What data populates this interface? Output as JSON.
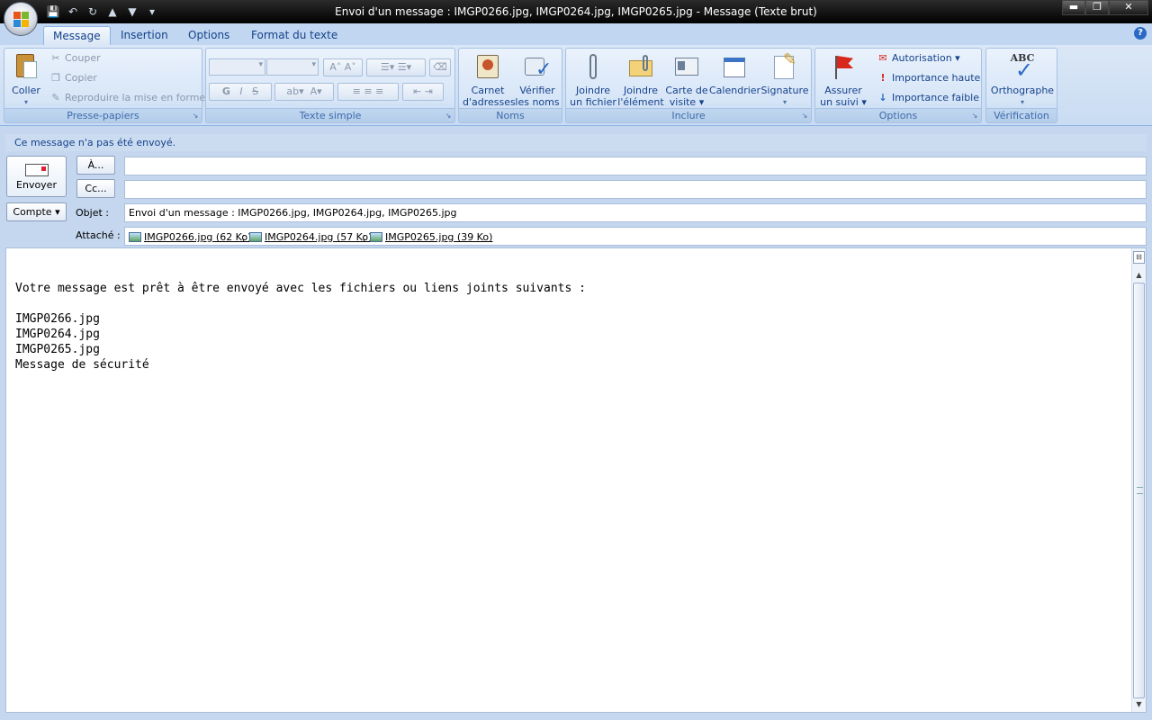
{
  "window": {
    "title": "Envoi d'un message : IMGP0266.jpg, IMGP0264.jpg, IMGP0265.jpg - Message (Texte brut)",
    "min": "▬",
    "max": "❐",
    "close": "✕"
  },
  "quick_access": [
    "💾",
    "↶",
    "↻",
    "▲",
    "▼",
    "▾"
  ],
  "tabs": [
    "Message",
    "Insertion",
    "Options",
    "Format du texte"
  ],
  "help": "?",
  "ribbon": {
    "clipboard": {
      "label": "Presse-papiers",
      "paste": "Coller",
      "cut": "Couper",
      "copy": "Copier",
      "format_painter": "Reproduire la mise en forme"
    },
    "basic_text": {
      "label": "Texte simple",
      "bold": "G",
      "italic": "I",
      "strike": "S",
      "font_color": "A"
    },
    "names": {
      "label": "Noms",
      "address_book_1": "Carnet",
      "address_book_2": "d'adresses",
      "check_names_1": "Vérifier",
      "check_names_2": "les noms"
    },
    "include": {
      "label": "Inclure",
      "attach_file_1": "Joindre",
      "attach_file_2": "un fichier",
      "attach_item_1": "Joindre",
      "attach_item_2": "l'élément",
      "business_card_1": "Carte de",
      "business_card_2": "visite ▾",
      "calendar": "Calendrier",
      "signature": "Signature"
    },
    "options": {
      "label": "Options",
      "follow_up_1": "Assurer",
      "follow_up_2": "un suivi ▾",
      "permission": "Autorisation ▾",
      "high_importance": "Importance haute",
      "low_importance": "Importance faible"
    },
    "proofing": {
      "label": "Vérification",
      "spelling": "Orthographe",
      "abc": "ABC"
    }
  },
  "infobar": "Ce message n'a pas été envoyé.",
  "header": {
    "send": "Envoyer",
    "to_button": "À...",
    "cc_button": "Cc...",
    "account_button": "Compte ▾",
    "subject_label": "Objet :",
    "subject_value": "Envoi d'un message : IMGP0266.jpg, IMGP0264.jpg, IMGP0265.jpg",
    "attached_label": "Attaché :",
    "to_value": "",
    "cc_value": "",
    "attachments": [
      "IMGP0266.jpg (62 Ko)",
      "IMGP0264.jpg (57 Ko)",
      "IMGP0265.jpg (39 Ko)"
    ],
    "separator": ";"
  },
  "body_text": "Votre message est prêt à être envoyé avec les fichiers ou liens joints suivants :\n\nIMGP0266.jpg\nIMGP0264.jpg\nIMGP0265.jpg\nMessage de sécurité"
}
